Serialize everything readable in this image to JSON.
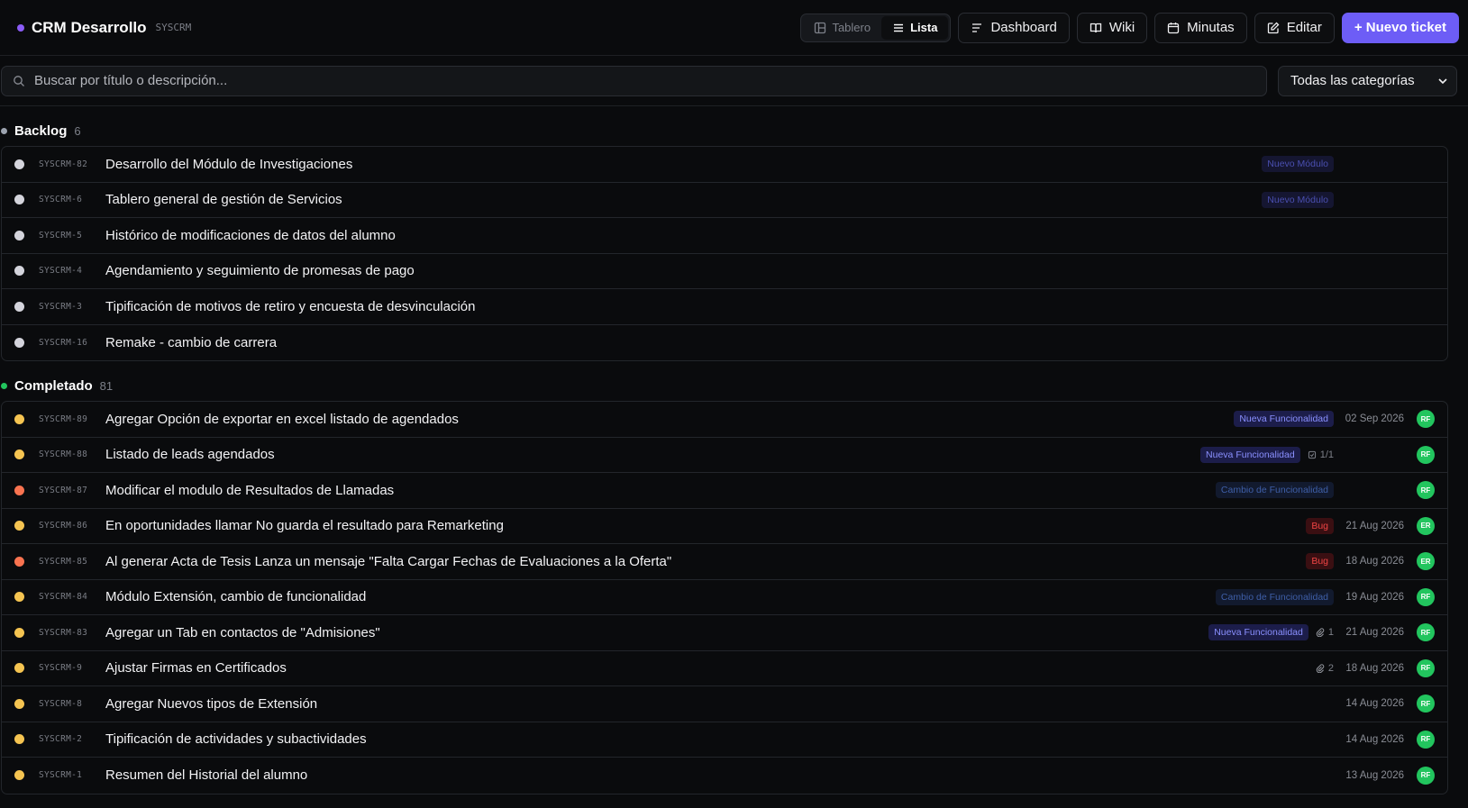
{
  "header": {
    "title": "CRM Desarrollo",
    "key": "SYSCRM",
    "accent": "#8b5cf6",
    "view_toggle": {
      "board_label": "Tablero",
      "list_label": "Lista",
      "active": "Lista"
    },
    "buttons": {
      "dashboard": "Dashboard",
      "wiki": "Wiki",
      "minutes": "Minutas",
      "edit": "Editar",
      "new_ticket": "+ Nuevo ticket"
    }
  },
  "filters": {
    "search_placeholder": "Buscar por título o descripción...",
    "category_value": "Todas las categorías"
  },
  "groups": [
    {
      "name": "Backlog",
      "count": "6",
      "color": "#9ca3af",
      "tickets": [
        {
          "key": "SYSCRM-82",
          "title": "Desarrollo del Módulo de Investigaciones",
          "dot": "#d4d4dc",
          "tag": "Nuevo Módulo",
          "tag_class": "nuevo-modulo",
          "sub": "",
          "date": "",
          "avatar": ""
        },
        {
          "key": "SYSCRM-6",
          "title": "Tablero general de gestión de Servicios",
          "dot": "#d4d4dc",
          "tag": "Nuevo Módulo",
          "tag_class": "nuevo-modulo",
          "sub": "",
          "date": "",
          "avatar": ""
        },
        {
          "key": "SYSCRM-5",
          "title": "Histórico de modificaciones de datos del alumno",
          "dot": "#d4d4dc",
          "tag": "",
          "tag_class": "",
          "sub": "",
          "date": "",
          "avatar": ""
        },
        {
          "key": "SYSCRM-4",
          "title": "Agendamiento y seguimiento de promesas de pago",
          "dot": "#d4d4dc",
          "tag": "",
          "tag_class": "",
          "sub": "",
          "date": "",
          "avatar": ""
        },
        {
          "key": "SYSCRM-3",
          "title": "Tipificación de motivos de retiro y encuesta de desvinculación",
          "dot": "#d4d4dc",
          "tag": "",
          "tag_class": "",
          "sub": "",
          "date": "",
          "avatar": ""
        },
        {
          "key": "SYSCRM-16",
          "title": "Remake - cambio de carrera",
          "dot": "#d4d4dc",
          "tag": "",
          "tag_class": "",
          "sub": "",
          "date": "",
          "avatar": ""
        }
      ]
    },
    {
      "name": "Completado",
      "count": "81",
      "color": "#22c55e",
      "tickets": [
        {
          "key": "SYSCRM-89",
          "title": "Agregar Opción de exportar en excel listado de agendados",
          "dot": "#f5c451",
          "tag": "Nueva Funcionalidad",
          "tag_class": "nueva-func",
          "sub": "",
          "date": "02 Sep 2026",
          "avatar": "RF"
        },
        {
          "key": "SYSCRM-88",
          "title": "Listado de leads agendados",
          "dot": "#f5c451",
          "tag": "Nueva Funcionalidad",
          "tag_class": "nueva-func",
          "sub": "1/1",
          "sub_icon": "checklist-icon",
          "date": "",
          "avatar": "RF"
        },
        {
          "key": "SYSCRM-87",
          "title": "Modificar el modulo de Resultados de Llamadas",
          "dot": "#f97350",
          "tag": "Cambio de Funcionalidad",
          "tag_class": "cambio-func",
          "sub": "",
          "date": "",
          "avatar": "RF"
        },
        {
          "key": "SYSCRM-86",
          "title": "En oportunidades llamar No guarda el resultado para Remarketing",
          "dot": "#f5c451",
          "tag": "Bug",
          "tag_class": "bug",
          "sub": "",
          "date": "21 Aug 2026",
          "avatar": "ER"
        },
        {
          "key": "SYSCRM-85",
          "title": "Al generar Acta de Tesis Lanza un mensaje \"Falta Cargar Fechas de Evaluaciones a la Oferta\"",
          "dot": "#f97350",
          "tag": "Bug",
          "tag_class": "bug",
          "sub": "",
          "date": "18 Aug 2026",
          "avatar": "ER"
        },
        {
          "key": "SYSCRM-84",
          "title": "Módulo Extensión, cambio de funcionalidad",
          "dot": "#f5c451",
          "tag": "Cambio de Funcionalidad",
          "tag_class": "cambio-func",
          "sub": "",
          "date": "19 Aug 2026",
          "avatar": "RF"
        },
        {
          "key": "SYSCRM-83",
          "title": "Agregar un Tab en contactos de \"Admisiones\"",
          "dot": "#f5c451",
          "tag": "Nueva Funcionalidad",
          "tag_class": "nueva-func",
          "sub": "1",
          "sub_icon": "attachment-icon",
          "date": "21 Aug 2026",
          "avatar": "RF"
        },
        {
          "key": "SYSCRM-9",
          "title": "Ajustar Firmas en Certificados",
          "dot": "#f5c451",
          "tag": "",
          "tag_class": "",
          "sub": "2",
          "sub_icon": "attachment-icon",
          "date": "18 Aug 2026",
          "avatar": "RF"
        },
        {
          "key": "SYSCRM-8",
          "title": "Agregar Nuevos tipos de Extensión",
          "dot": "#f5c451",
          "tag": "",
          "tag_class": "",
          "sub": "",
          "date": "14 Aug 2026",
          "avatar": "RF"
        },
        {
          "key": "SYSCRM-2",
          "title": "Tipificación de actividades y subactividades",
          "dot": "#f5c451",
          "tag": "",
          "tag_class": "",
          "sub": "",
          "date": "14 Aug 2026",
          "avatar": "RF"
        },
        {
          "key": "SYSCRM-1",
          "title": "Resumen del Historial del alumno",
          "dot": "#f5c451",
          "tag": "",
          "tag_class": "",
          "sub": "",
          "date": "13 Aug 2026",
          "avatar": "RF"
        }
      ]
    }
  ]
}
